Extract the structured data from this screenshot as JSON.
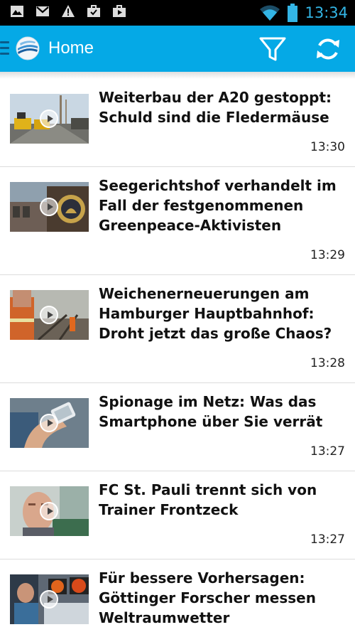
{
  "status_bar": {
    "time": "13:34",
    "left_icons": [
      "image-icon",
      "gmail-icon",
      "warning-icon",
      "briefcase-icon",
      "shopping-bag-icon"
    ],
    "right_icons": [
      "wifi-icon",
      "battery-icon"
    ]
  },
  "action_bar": {
    "title": "Home",
    "logo_icon": "sat1-logo-icon",
    "filter_icon": "filter-icon",
    "refresh_icon": "refresh-icon",
    "background_color": "#05a9e6"
  },
  "articles": [
    {
      "headline": "Weiterbau der A20 gestoppt: Schuld sind die Fledermäuse",
      "time": "13:30",
      "thumbnail_icon": "video-thumbnail-road-construction"
    },
    {
      "headline": "Seegerichtshof verhandelt im Fall der festgenommenen Greenpeace-Aktivisten",
      "time": "13:29",
      "thumbnail_icon": "video-thumbnail-court-emblem"
    },
    {
      "headline": "Weichenerneuerungen am Hamburger Hauptbahnhof: Droht jetzt das große Chaos?",
      "time": "13:28",
      "thumbnail_icon": "video-thumbnail-railway-workers"
    },
    {
      "headline": "Spionage im Netz: Was das Smartphone über Sie verrät",
      "time": "13:27",
      "thumbnail_icon": "video-thumbnail-smartphone-hand"
    },
    {
      "headline": "FC St. Pauli trennt sich von Trainer Frontzeck",
      "time": "13:27",
      "thumbnail_icon": "video-thumbnail-coach-portrait"
    },
    {
      "headline": "Für bessere Vorhersagen: Göttinger Forscher messen Weltraumwetter",
      "time": "",
      "thumbnail_icon": "video-thumbnail-researchers-monitors"
    }
  ]
}
